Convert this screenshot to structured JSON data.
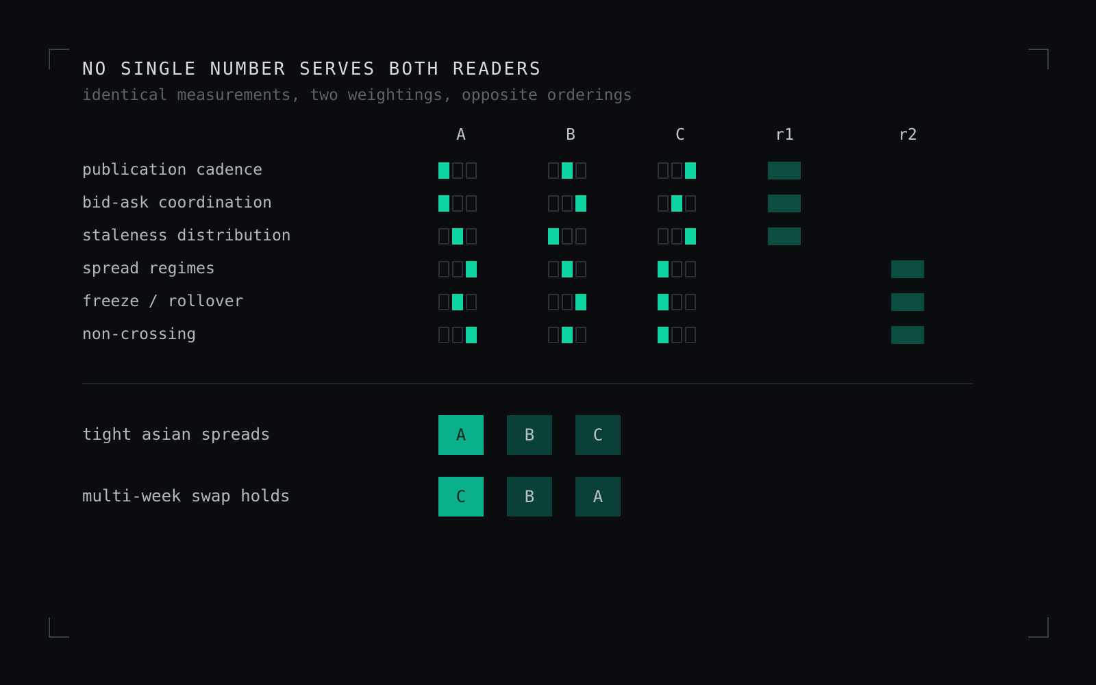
{
  "title": "NO SINGLE NUMBER SERVES BOTH READERS",
  "subtitle": "identical measurements, two weightings, opposite orderings",
  "columns": [
    "A",
    "B",
    "C",
    "r1",
    "r2"
  ],
  "metrics": [
    {
      "label": "publication cadence",
      "ranks": {
        "A": 1,
        "B": 2,
        "C": 3
      },
      "reader": "r1"
    },
    {
      "label": "bid-ask coordination",
      "ranks": {
        "A": 1,
        "B": 3,
        "C": 2
      },
      "reader": "r1"
    },
    {
      "label": "staleness distribution",
      "ranks": {
        "A": 2,
        "B": 1,
        "C": 3
      },
      "reader": "r1"
    },
    {
      "label": "spread regimes",
      "ranks": {
        "A": 3,
        "B": 2,
        "C": 1
      },
      "reader": "r2"
    },
    {
      "label": "freeze / rollover",
      "ranks": {
        "A": 2,
        "B": 3,
        "C": 1
      },
      "reader": "r2"
    },
    {
      "label": "non-crossing",
      "ranks": {
        "A": 3,
        "B": 2,
        "C": 1
      },
      "reader": "r2"
    }
  ],
  "orderings": [
    {
      "label": "tight asian spreads",
      "order": [
        "A",
        "B",
        "C"
      ]
    },
    {
      "label": "multi-week swap holds",
      "order": [
        "C",
        "B",
        "A"
      ]
    }
  ],
  "colors": {
    "background": "#0a0c10",
    "cell_on": "#0fd4a4",
    "cell_border": "#2c3139",
    "reader_bar": "#0b4d40",
    "rank_first": "#0ab08b",
    "rank_other": "#0b4038"
  }
}
